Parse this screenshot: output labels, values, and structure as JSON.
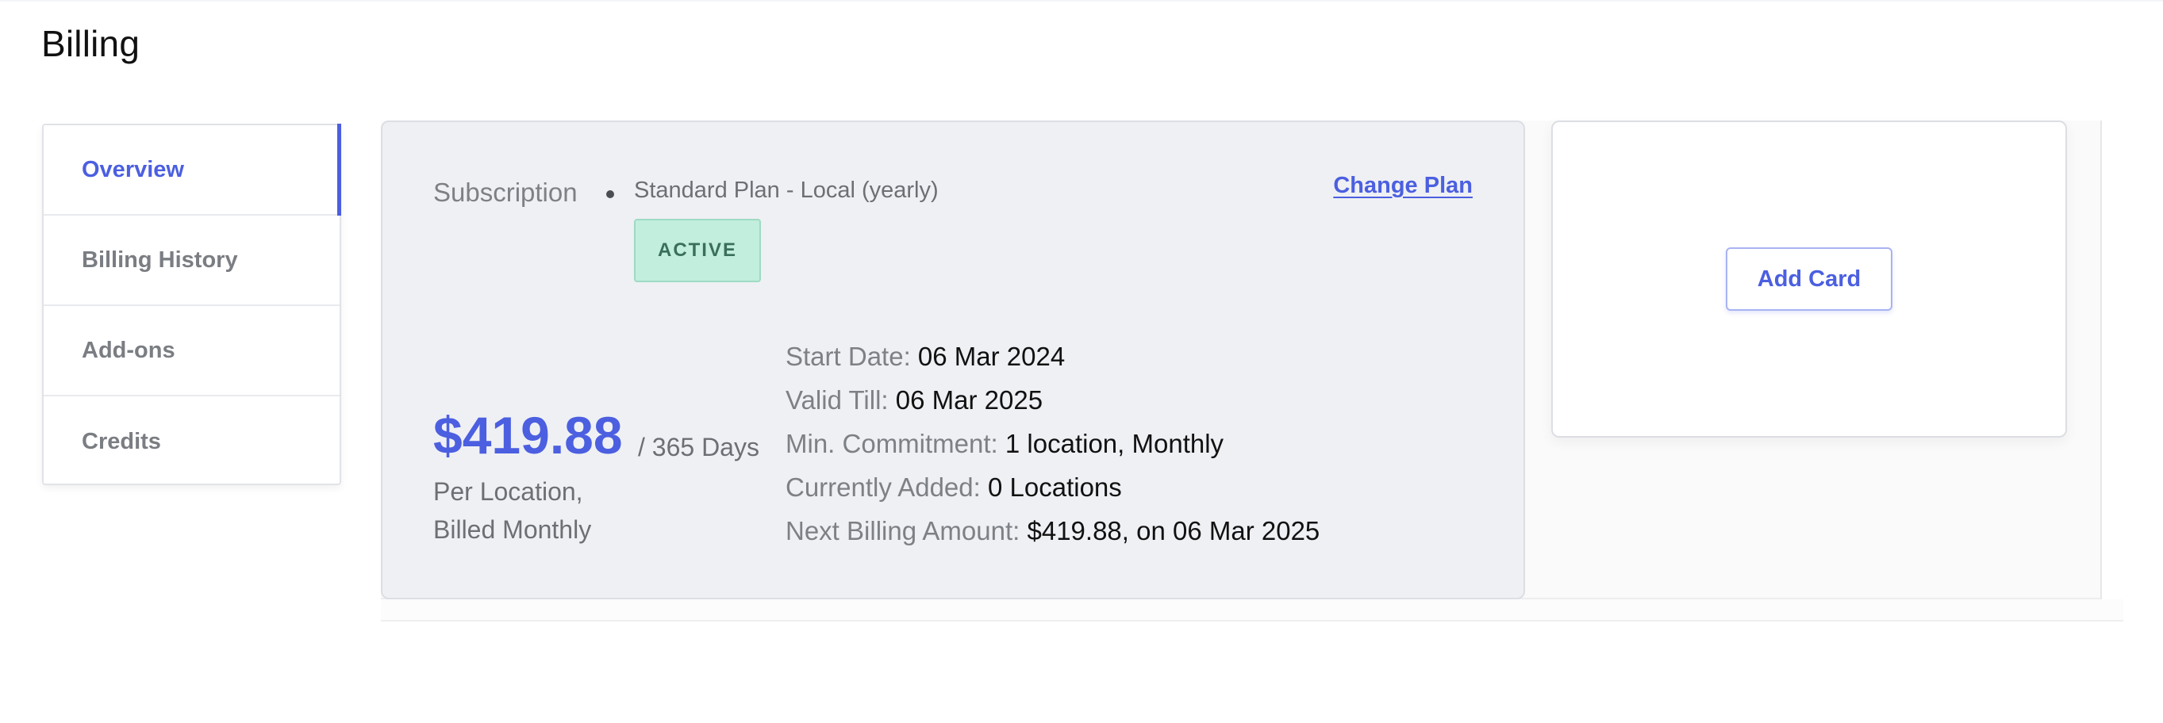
{
  "page": {
    "title": "Billing"
  },
  "sidebar": {
    "items": [
      {
        "label": "Overview",
        "active": true
      },
      {
        "label": "Billing History",
        "active": false
      },
      {
        "label": "Add-ons",
        "active": false
      },
      {
        "label": "Credits",
        "active": false
      }
    ]
  },
  "subscription": {
    "label": "Subscription",
    "plan_name": "Standard Plan - Local (yearly)",
    "status": "ACTIVE",
    "change_plan_label": "Change Plan",
    "price": "$419.88",
    "period": "/ 365 Days",
    "note_line1": "Per Location,",
    "note_line2": "Billed Monthly",
    "details": [
      {
        "label": "Start Date:",
        "value": "06 Mar 2024"
      },
      {
        "label": "Valid Till:",
        "value": "06 Mar 2025"
      },
      {
        "label": "Min. Commitment:",
        "value": "1 location, Monthly"
      },
      {
        "label": "Currently Added:",
        "value": "0 Locations"
      },
      {
        "label": "Next Billing Amount:",
        "value": "$419.88, on 06 Mar 2025"
      }
    ]
  },
  "card": {
    "add_card_label": "Add Card"
  },
  "colors": {
    "accent": "#4b5fe0",
    "active_badge_bg": "#c2eedd",
    "active_badge_text": "#3a6f5a",
    "card_bg": "#eff0f4"
  }
}
